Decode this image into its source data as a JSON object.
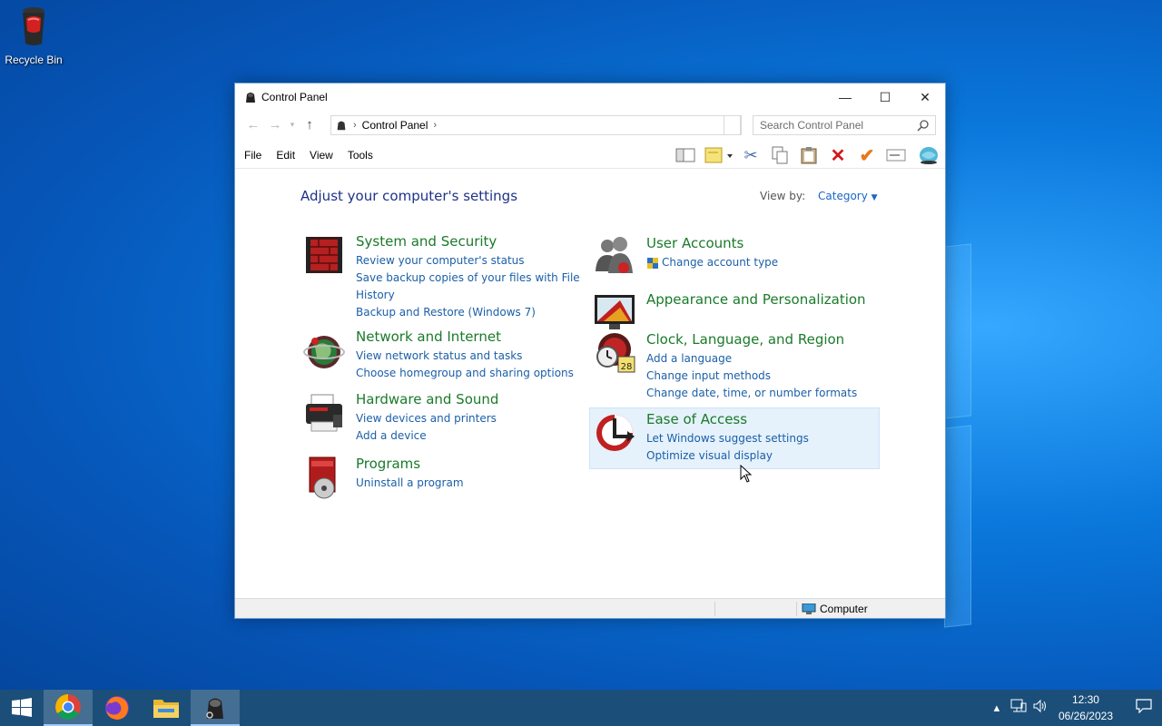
{
  "desktop": {
    "recycle_bin_label": "Recycle Bin"
  },
  "window": {
    "title": "Control Panel",
    "minimize_glyph": "—",
    "maximize_glyph": "☐",
    "close_glyph": "✕",
    "address": {
      "crumb": "Control Panel"
    },
    "search_placeholder": "Search Control Panel",
    "menu": [
      "File",
      "Edit",
      "View",
      "Tools"
    ],
    "heading": "Adjust your computer's settings",
    "view_by_label": "View by:",
    "view_by_value": "Category",
    "categories": [
      {
        "title": "System and Security",
        "links": [
          "Review your computer's status",
          "Save backup copies of your files with File",
          "History",
          "Backup and Restore (Windows 7)"
        ]
      },
      {
        "title": "Network and Internet",
        "links": [
          "View network status and tasks",
          "Choose homegroup and sharing options"
        ]
      },
      {
        "title": "Hardware and Sound",
        "links": [
          "View devices and printers",
          "Add a device"
        ]
      },
      {
        "title": "Programs",
        "links": [
          "Uninstall a program"
        ]
      },
      {
        "title": "User Accounts",
        "links": [
          "Change account type"
        ]
      },
      {
        "title": "Appearance and Personalization",
        "links": []
      },
      {
        "title": "Clock, Language, and Region",
        "links": [
          "Add a language",
          "Change input methods",
          "Change date, time, or number formats"
        ]
      },
      {
        "title": "Ease of Access",
        "links": [
          "Let Windows suggest settings",
          "Optimize visual display"
        ]
      }
    ],
    "status_bar": {
      "location": "Computer"
    }
  },
  "taskbar": {
    "time": "12:30",
    "date": "06/26/2023"
  }
}
